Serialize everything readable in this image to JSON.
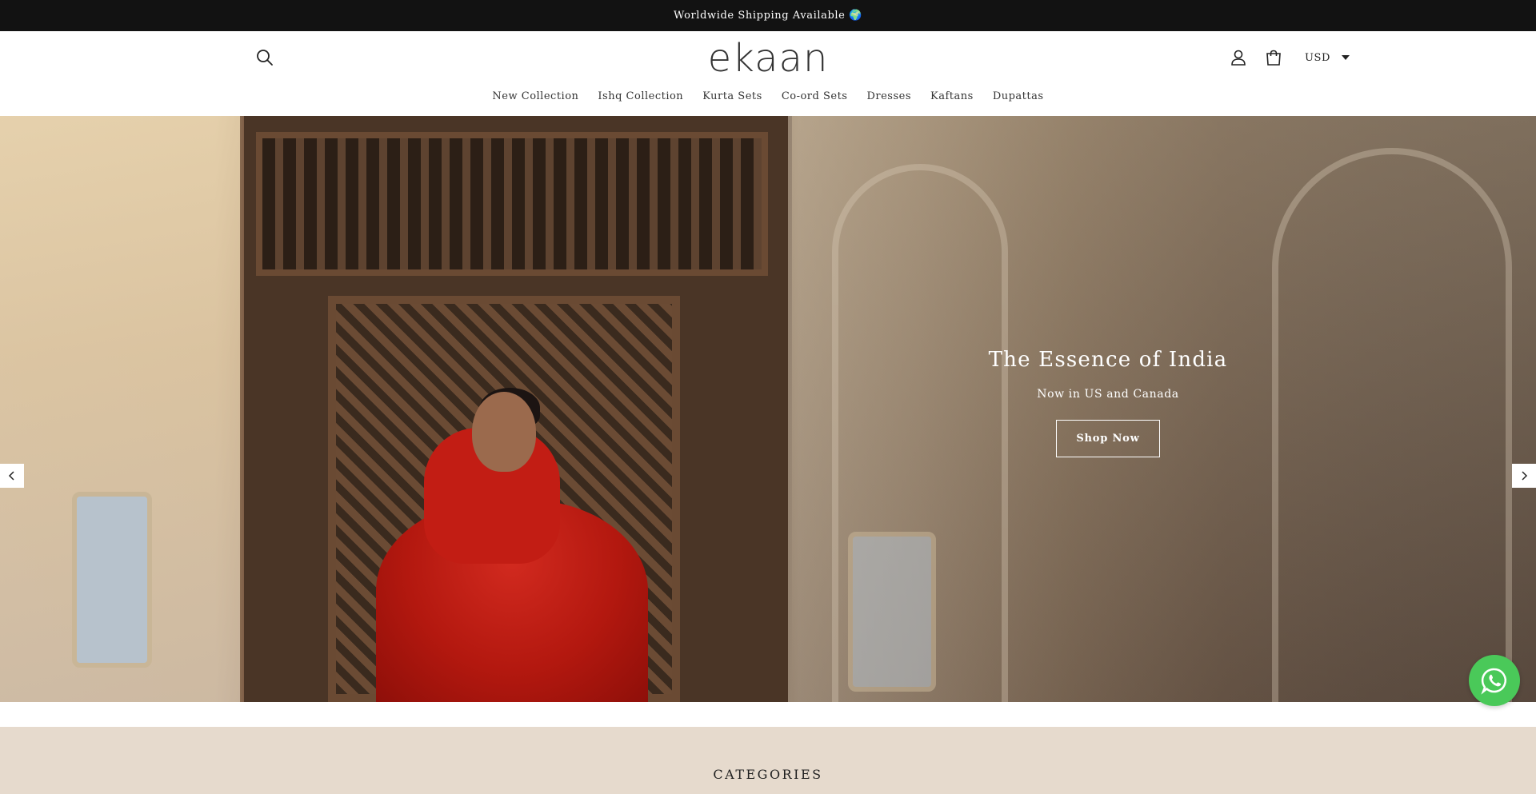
{
  "announcement": {
    "text": "Worldwide Shipping Available 🌍"
  },
  "header": {
    "logo": "ekaan",
    "currency": "USD",
    "icons": {
      "search": "search-icon",
      "account": "user-icon",
      "cart": "bag-icon"
    }
  },
  "nav": {
    "items": [
      {
        "label": "New Collection"
      },
      {
        "label": "Ishq Collection"
      },
      {
        "label": "Kurta Sets"
      },
      {
        "label": "Co-ord Sets"
      },
      {
        "label": "Dresses"
      },
      {
        "label": "Kaftans"
      },
      {
        "label": "Dupattas"
      }
    ]
  },
  "hero": {
    "title": "The Essence of India",
    "subtitle": "Now in US and Canada",
    "cta": "Shop Now"
  },
  "sections": {
    "categories_title": "CATEGORIES"
  },
  "colors": {
    "announcement_bg": "#121212",
    "categories_bg": "#e6dacd",
    "whatsapp": "#4ac959"
  }
}
